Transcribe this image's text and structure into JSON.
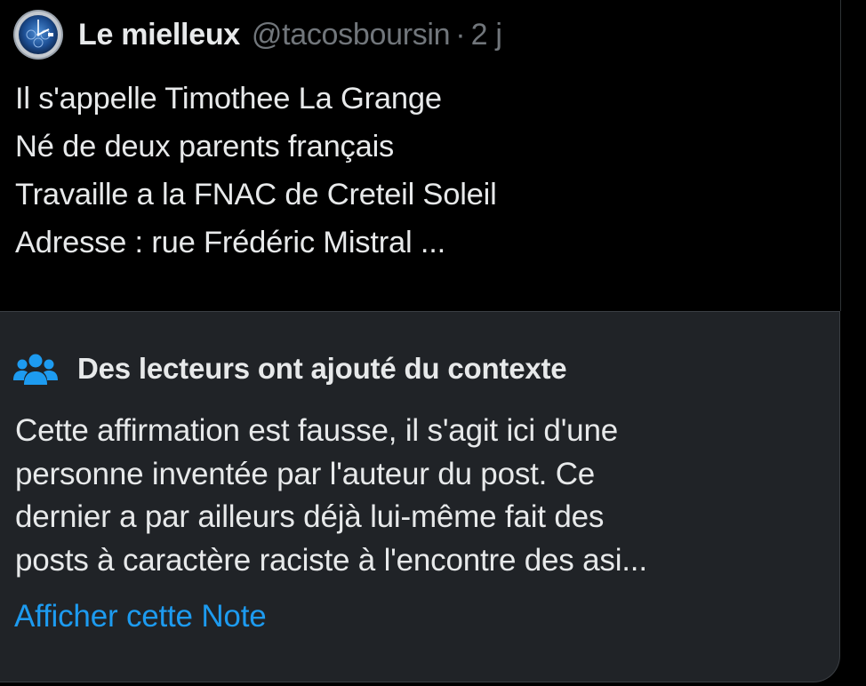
{
  "post": {
    "author": {
      "display_name": "Le mielleux",
      "handle": "@tacosboursin",
      "avatar_icon": "watch-avatar-icon"
    },
    "separator": "·",
    "time": "2 j",
    "lines": [
      "Il s'appelle Timothee La Grange",
      "Né de deux parents français",
      "Travaille a la FNAC de Creteil Soleil",
      "Adresse : rue Frédéric Mistral ..."
    ]
  },
  "community_note": {
    "icon": "people-icon",
    "title": "Des lecteurs ont ajouté du contexte",
    "lines": [
      "Cette affirmation est fausse, il s'agit ici d'une",
      "personne inventée par l'auteur du post. Ce",
      "dernier a par ailleurs déjà lui-même fait des",
      "posts à caractère raciste à l'encontre des asi..."
    ],
    "link_label": "Afficher cette Note"
  },
  "colors": {
    "background": "#000000",
    "text_primary": "#e7e9ea",
    "text_secondary": "#71767b",
    "note_background": "#202327",
    "accent_blue": "#1d9bf0"
  }
}
